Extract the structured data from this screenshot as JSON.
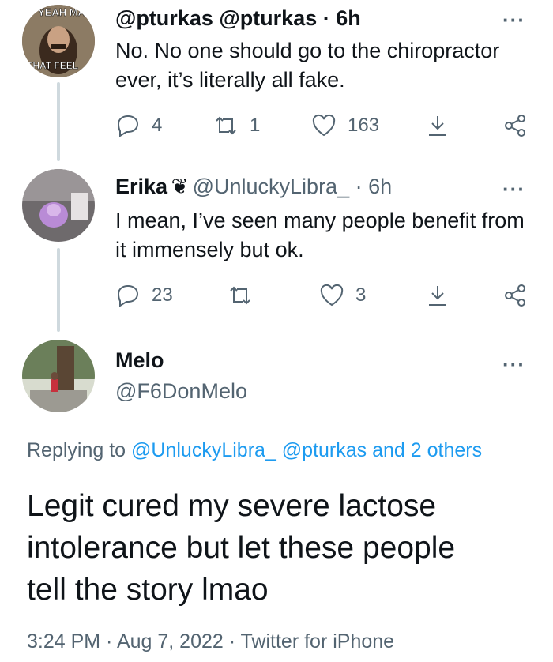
{
  "tweets": [
    {
      "display_name": "",
      "handle_line": "@pturkas @pturkas · 6h",
      "avatar_overlay_top": "YEAH MA",
      "avatar_overlay_bottom": "THAT FEEL",
      "text_line1": "No. No one should go to the chiropractor",
      "text_line2": "ever, it’s literally all fake.",
      "reply_count": "4",
      "retweet_count": "1",
      "like_count": "163",
      "more": "···"
    },
    {
      "display_name": "Erika",
      "badge": "❦",
      "handle_line": "@UnluckyLibra_ · 6h",
      "text_line1": "I mean, I’ve seen many people benefit from",
      "text_line2": "it immensely but ok.",
      "reply_count": "23",
      "retweet_count": "",
      "like_count": "3",
      "more": "···"
    }
  ],
  "main_tweet": {
    "display_name": "Melo",
    "handle": "@F6DonMelo",
    "more": "···",
    "replying_prefix": "Replying to",
    "replying_user1": "@UnluckyLibra_",
    "replying_user2": "@pturkas",
    "replying_suffix": "and 2 others",
    "text_line1": "Legit cured my severe lactose",
    "text_line2": "intolerance but let these people",
    "text_line3": "tell the story lmao",
    "timestamp": "3:24 PM · Aug 7, 2022 · Twitter for iPhone"
  },
  "colors": {
    "link": "#1d9bf0",
    "secondary_text": "#536471",
    "thread_line": "#cfd9de"
  }
}
